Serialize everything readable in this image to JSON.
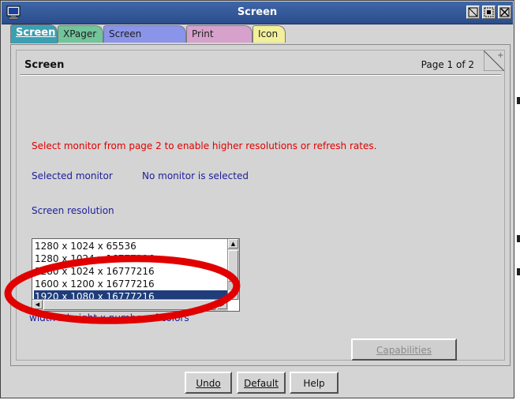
{
  "window": {
    "title": "Screen",
    "colors": {
      "titlebar": "#2f56a0",
      "warning": "#e00000",
      "label": "#1d1d9a",
      "selection": "#1f3d7a",
      "ring": "#e00000"
    }
  },
  "tabs": [
    {
      "label": "Screen",
      "color": "#3c9fb2",
      "active": true
    },
    {
      "label": "XPager",
      "color": "#72c49a",
      "active": false
    },
    {
      "label": "Screen Borders",
      "color": "#8a94e8",
      "active": false
    },
    {
      "label": "Print Screen",
      "color": "#d6a2cc",
      "active": false
    },
    {
      "label": "Icon",
      "color": "#f2f09a",
      "active": false
    }
  ],
  "page": {
    "title": "Screen",
    "page_indicator": "Page 1 of 2",
    "warning": "Select monitor from page 2 to enable higher resolutions or refresh rates.",
    "selected_monitor_label": "Selected monitor",
    "selected_monitor_value": "No monitor is selected",
    "resolution_label": "Screen resolution",
    "resolutions": [
      "1280 x 1024 x 65536",
      "1280 x 1024 x 16777216",
      "1280 x 1024 x 16777216",
      "1600 x 1200 x 16777216",
      "1920 x 1080 x 16777216"
    ],
    "selected_resolution_index": 4,
    "hint": "width x height x number of colors",
    "capabilities_button": "Capabilities"
  },
  "buttons": {
    "undo": "Undo",
    "default": "Default",
    "help": "Help"
  },
  "icons": {
    "app": "monitor-icon",
    "maximize": "maximize-icon",
    "restore": "restore-icon",
    "close": "close-icon",
    "page_turn": "page-turn-icon"
  }
}
